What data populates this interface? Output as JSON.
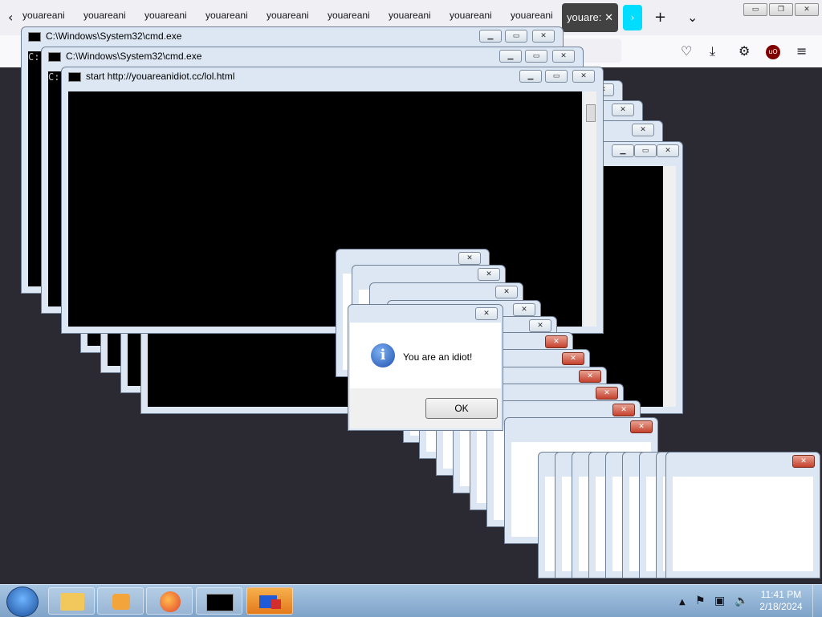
{
  "browser": {
    "tabs": [
      "youareani",
      "youareani",
      "youareani",
      "youareani",
      "youareani",
      "youareani",
      "youareani",
      "youareani",
      "youareani"
    ],
    "active_tab": "youare:",
    "controls": {
      "minimize": "▭",
      "restore": "❐",
      "close": "✕"
    }
  },
  "cmd_windows": [
    {
      "title": "C:\\Windows\\System32\\cmd.exe",
      "body_text": "C:"
    },
    {
      "title": "C:\\Windows\\System32\\cmd.exe",
      "body_text": "C:"
    },
    {
      "title": "start  http://youareanidiot.cc/lol.html",
      "body_text": ""
    }
  ],
  "dialog": {
    "message": "You are an idiot!",
    "ok_label": "OK"
  },
  "taskbar": {
    "time": "11:41 PM",
    "date": "2/18/2024"
  },
  "colors": {
    "dialog_close_red": "#c4412c",
    "taskbar": "#7ea2c8",
    "desktop": "#2b2a33"
  }
}
